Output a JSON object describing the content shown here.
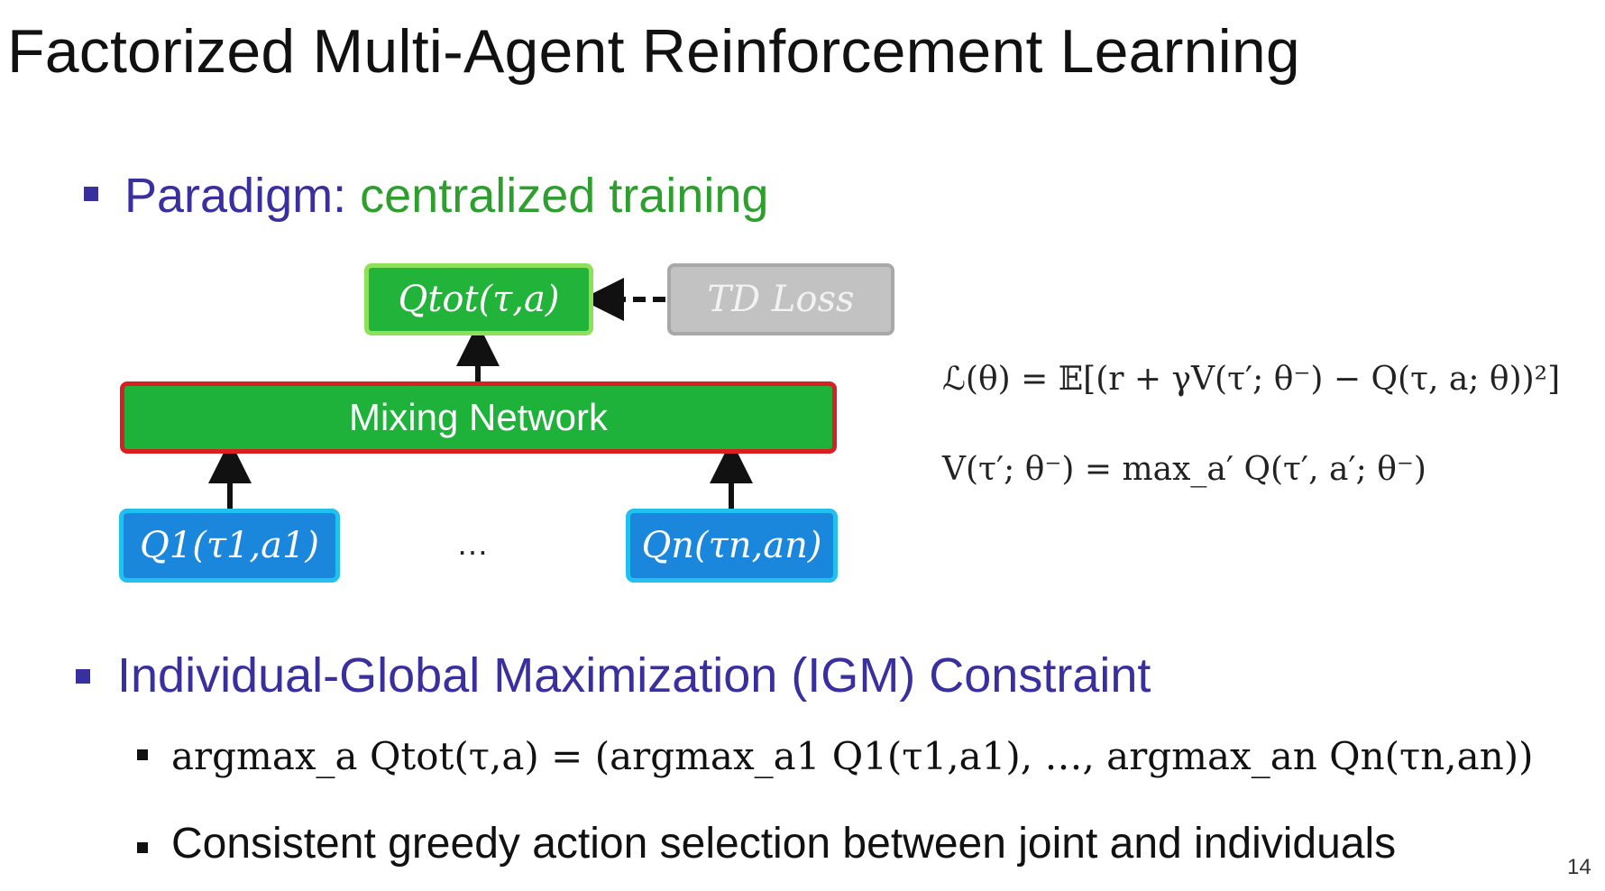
{
  "title": "Factorized Multi-Agent Reinforcement Learning",
  "bullet1": {
    "label": "Paradigm:",
    "highlight": "centralized training"
  },
  "diagram": {
    "qtot_label": "Qtot(τ,a)",
    "td_loss_label": "TD Loss",
    "mixing_label": "Mixing Network",
    "q1_label": "Q1(τ1,a1)",
    "qn_label": "Qn(τn,an)",
    "ellipsis": "…"
  },
  "equations": {
    "loss": "ℒ(θ) = 𝔼[(r + γV(τ′; θ⁻) − Q(τ, a; θ))²]",
    "value": "V(τ′; θ⁻) = max_a′ Q(τ′, a′; θ⁻)"
  },
  "bullet2": {
    "label": "Individual-Global Maximization (IGM) Constraint"
  },
  "sub_bullets": {
    "igm_equation": "argmax_a Qtot(τ,a) = (argmax_a1 Q1(τ1,a1), …, argmax_an Qn(τn,an))",
    "greedy": "Consistent greedy action selection between joint and individuals"
  },
  "page_number": "14",
  "colors": {
    "heading_blue": "#3a2f9e",
    "green_text": "#2e9e2e",
    "qtot_fill": "#22b33a",
    "mixing_border": "#d82020",
    "agent_fill": "#1a86dc",
    "td_loss_fill": "#c2c2c2"
  }
}
